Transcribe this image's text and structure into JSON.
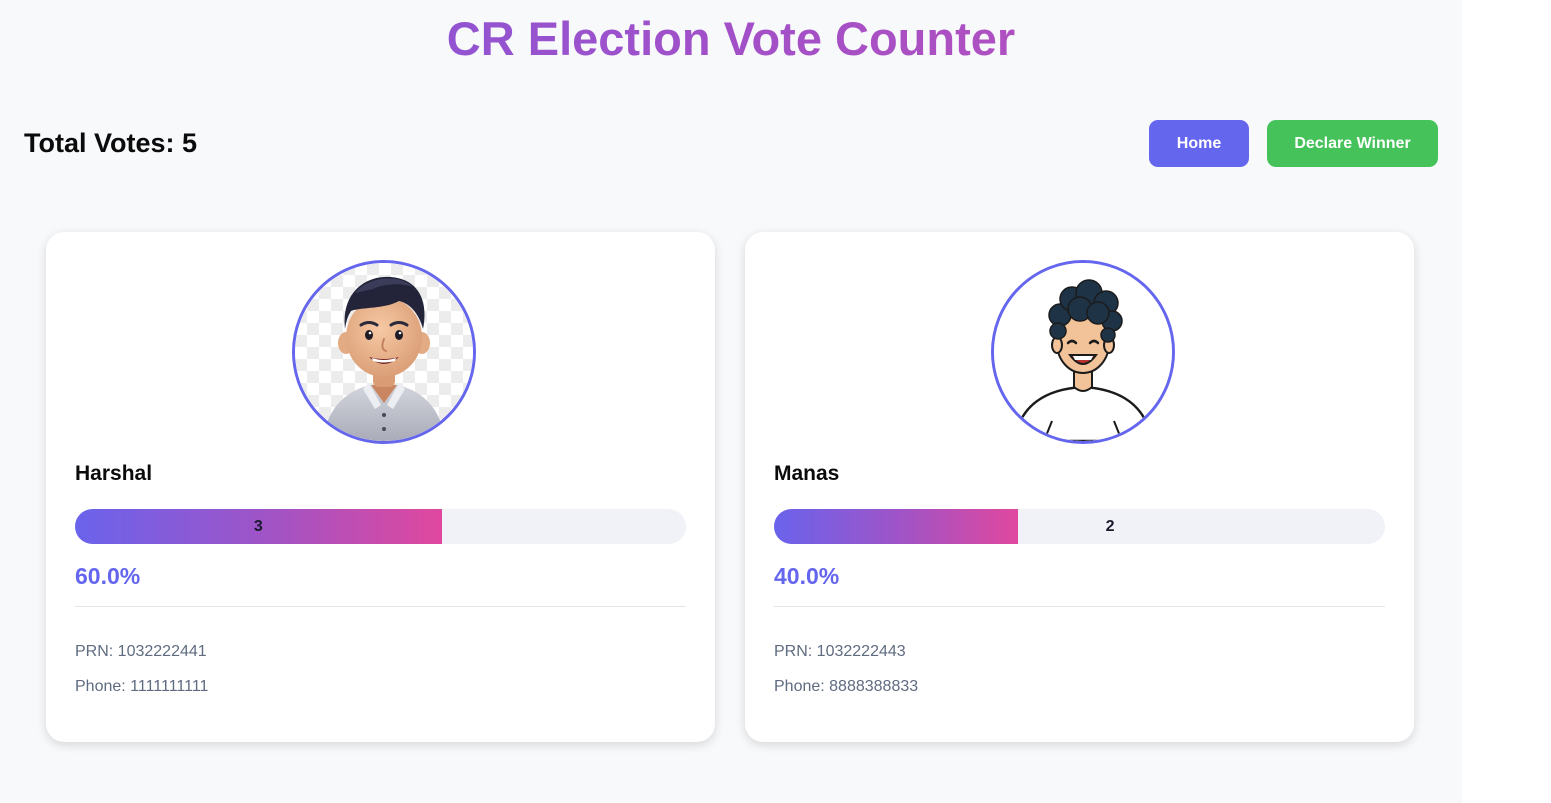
{
  "title": "CR Election Vote Counter",
  "total_votes_label": "Total Votes: 5",
  "total_votes": 5,
  "buttons": {
    "home": "Home",
    "declare_winner": "Declare Winner"
  },
  "colors": {
    "accent": "#6566ee",
    "success": "#45c35a",
    "progress_start": "#6a63ec",
    "progress_end": "#e0489e",
    "muted_text": "#5f6b80"
  },
  "candidates": [
    {
      "name": "Harshal",
      "votes": 3,
      "votes_label": "3",
      "percent": 60.0,
      "percent_label": "60.0%",
      "prn_label": "PRN: 1032222441",
      "phone_label": "Phone: 1111111111",
      "avatar_icon": "3d-boy-avatar-icon"
    },
    {
      "name": "Manas",
      "votes": 2,
      "votes_label": "2",
      "percent": 40.0,
      "percent_label": "40.0%",
      "prn_label": "PRN: 1032222443",
      "phone_label": "Phone: 8888388833",
      "avatar_icon": "cartoon-curly-hair-avatar-icon"
    }
  ]
}
